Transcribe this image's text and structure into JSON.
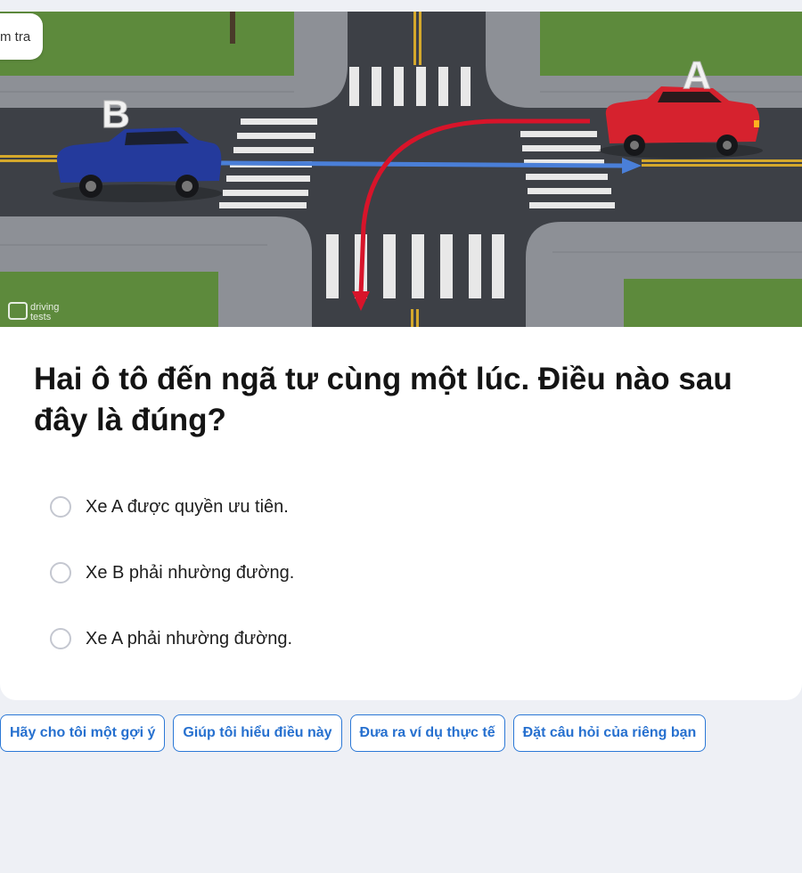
{
  "scene": {
    "label_a": "A",
    "label_b": "B",
    "watermark_line1": "driving",
    "watermark_line2": "tests",
    "car_a_color": "#d6222e",
    "car_b_color": "#243a9c",
    "path_a_color": "#d8142a",
    "path_b_color": "#4a7fd8"
  },
  "tag": {
    "label": "m tra"
  },
  "question": {
    "text": "Hai ô tô đến ngã tư cùng một lúc. Điều nào sau đây là đúng?"
  },
  "options": [
    {
      "label": "Xe A được quyền ưu tiên."
    },
    {
      "label": "Xe B phải nhường đường."
    },
    {
      "label": "Xe A phải nhường đường."
    }
  ],
  "chips": [
    {
      "label": "Hãy cho tôi một gợi ý"
    },
    {
      "label": "Giúp tôi hiểu điều này"
    },
    {
      "label": "Đưa ra ví dụ thực tế"
    },
    {
      "label": "Đặt câu hỏi của riêng bạn"
    }
  ],
  "colors": {
    "page_bg": "#eef0f5",
    "accent": "#2670cf",
    "text": "#141414"
  }
}
